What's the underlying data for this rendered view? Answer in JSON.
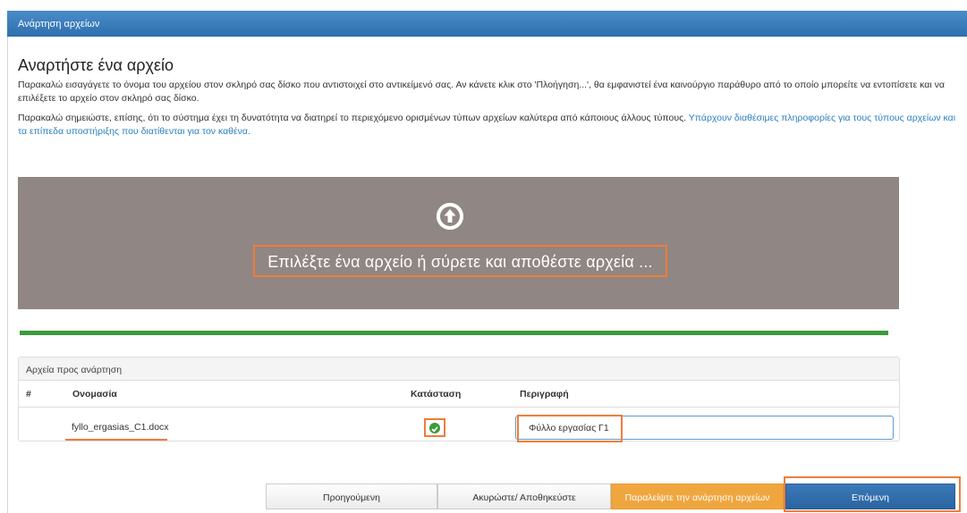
{
  "window": {
    "title": "Ανάρτηση αρχείων"
  },
  "intro": {
    "heading": "Αναρτήστε ένα αρχείο",
    "paragraph1": "Παρακαλώ εισαγάγετε το όνομα του αρχείου στον σκληρό σας δίσκο που αντιστοιχεί στο αντικείμενό σας. Αν κάνετε κλικ στο 'Πλοήγηση...', θα εμφανιστεί ένα καινούργιο παράθυρο από το οποίο μπορείτε να εντοπίσετε και να επιλέξετε το αρχείο στον σκληρό σας δίσκο.",
    "paragraph2_text": "Παρακαλώ σημειώστε, επίσης, ότι το σύστημα έχει τη δυνατότητα να διατηρεί το περιεχόμενο ορισμένων τύπων αρχείων καλύτερα από κάποιους άλλους τύπους. ",
    "paragraph2_link": "Υπάρχουν διαθέσιμες πληροφορίες για τους τύπους αρχείων και τα επίπεδα υποστήριξης που διατίθενται για τον καθένα."
  },
  "dropzone": {
    "icon": "upload-arrow-circle",
    "label": "Επιλέξτε ένα αρχείο ή σύρετε και αποθέστε αρχεία ...",
    "progress_percent": 100,
    "progress_color": "#3c9a3c"
  },
  "files_panel": {
    "title": "Αρχεία προς ανάρτηση",
    "columns": {
      "index": "#",
      "name": "Ονομασία",
      "status": "Κατάσταση",
      "description": "Περιγραφή"
    },
    "rows": [
      {
        "index": "",
        "name": "fyllo_ergasias_C1.docx",
        "status_icon": "check-circle",
        "description": "Φύλλο εργασίας Γ1"
      }
    ]
  },
  "buttons": {
    "previous": "Προηγούμενη",
    "cancel": "Ακυρώστε/ Αποθηκεύστε",
    "skip": "Παραλείψτε την ανάρτηση αρχείων",
    "next": "Επόμενη"
  },
  "colors": {
    "accent": "#2f6fae",
    "highlight": "#f07c3a",
    "dropzone": "#908683",
    "skip": "#f0a63f"
  }
}
